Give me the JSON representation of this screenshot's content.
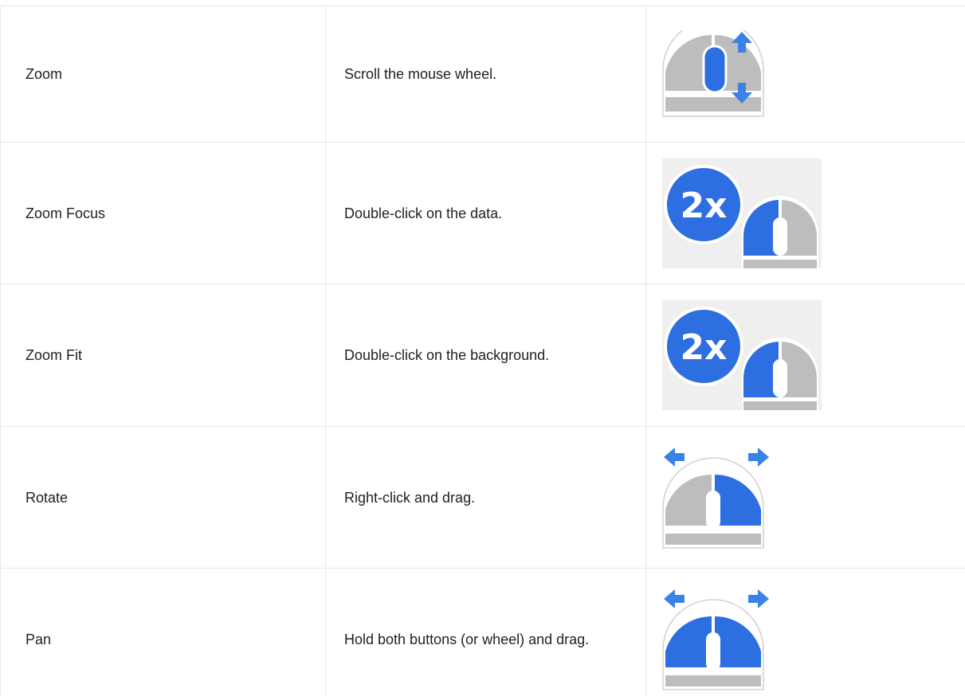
{
  "colors": {
    "accent_blue": "#2d6ee0",
    "arrow_blue": "#3b82e6",
    "mouse_gray": "#bdbdbd",
    "icon_bg_gray": "#efefef",
    "border": "#e6e6e6"
  },
  "controls": [
    {
      "action": "Zoom",
      "description": "Scroll the mouse wheel.",
      "icon": "mouse-scroll-wheel-icon"
    },
    {
      "action": "Zoom Focus",
      "description": "Double-click on the data.",
      "icon": "double-click-zoom-icon",
      "badge": "2x"
    },
    {
      "action": "Zoom Fit",
      "description": "Double-click on the background.",
      "icon": "double-click-zoom-icon",
      "badge": "2x"
    },
    {
      "action": "Rotate",
      "description": "Right-click and drag.",
      "icon": "right-click-drag-icon"
    },
    {
      "action": "Pan",
      "description": "Hold both buttons (or wheel) and drag.",
      "icon": "both-buttons-drag-icon"
    }
  ]
}
